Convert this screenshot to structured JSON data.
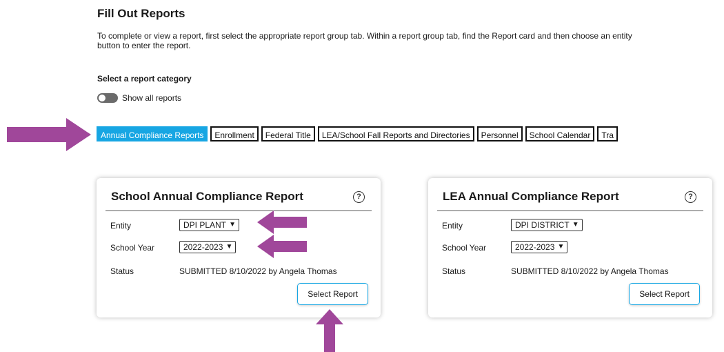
{
  "page": {
    "title": "Fill Out Reports",
    "intro_line1": "To complete or view a report, first select the appropriate report group tab. Within a report group tab, find the Report card and then choose an entity",
    "intro_line2": "button to enter the report.",
    "category_label": "Select a report category",
    "toggle_label": "Show all reports"
  },
  "tabs": [
    {
      "label": "Annual Compliance Reports",
      "active": true
    },
    {
      "label": "Enrollment"
    },
    {
      "label": "Federal Title"
    },
    {
      "label": "LEA/School Fall Reports and Directories"
    },
    {
      "label": "Personnel"
    },
    {
      "label": "School Calendar"
    },
    {
      "label": "Tra"
    }
  ],
  "cards": [
    {
      "title": "School Annual Compliance Report",
      "help_icon": "?",
      "entity_label": "Entity",
      "entity_value": "DPI PLANT",
      "year_label": "School Year",
      "year_value": "2022-2023",
      "status_label": "Status",
      "status_value": "SUBMITTED 8/10/2022 by Angela Thomas",
      "button_label": "Select Report"
    },
    {
      "title": "LEA Annual Compliance Report",
      "help_icon": "?",
      "entity_label": "Entity",
      "entity_value": "DPI DISTRICT",
      "year_label": "School Year",
      "year_value": "2022-2023",
      "status_label": "Status",
      "status_value": "SUBMITTED 8/10/2022 by Angela Thomas",
      "button_label": "Select Report"
    }
  ],
  "colors": {
    "accent": "#17a6e3",
    "annotation_arrow": "#a0479a"
  },
  "icons": {
    "help": "question-circle-icon",
    "dropdown": "chevron-down-icon",
    "annotation": "arrow-annotation-icon"
  }
}
